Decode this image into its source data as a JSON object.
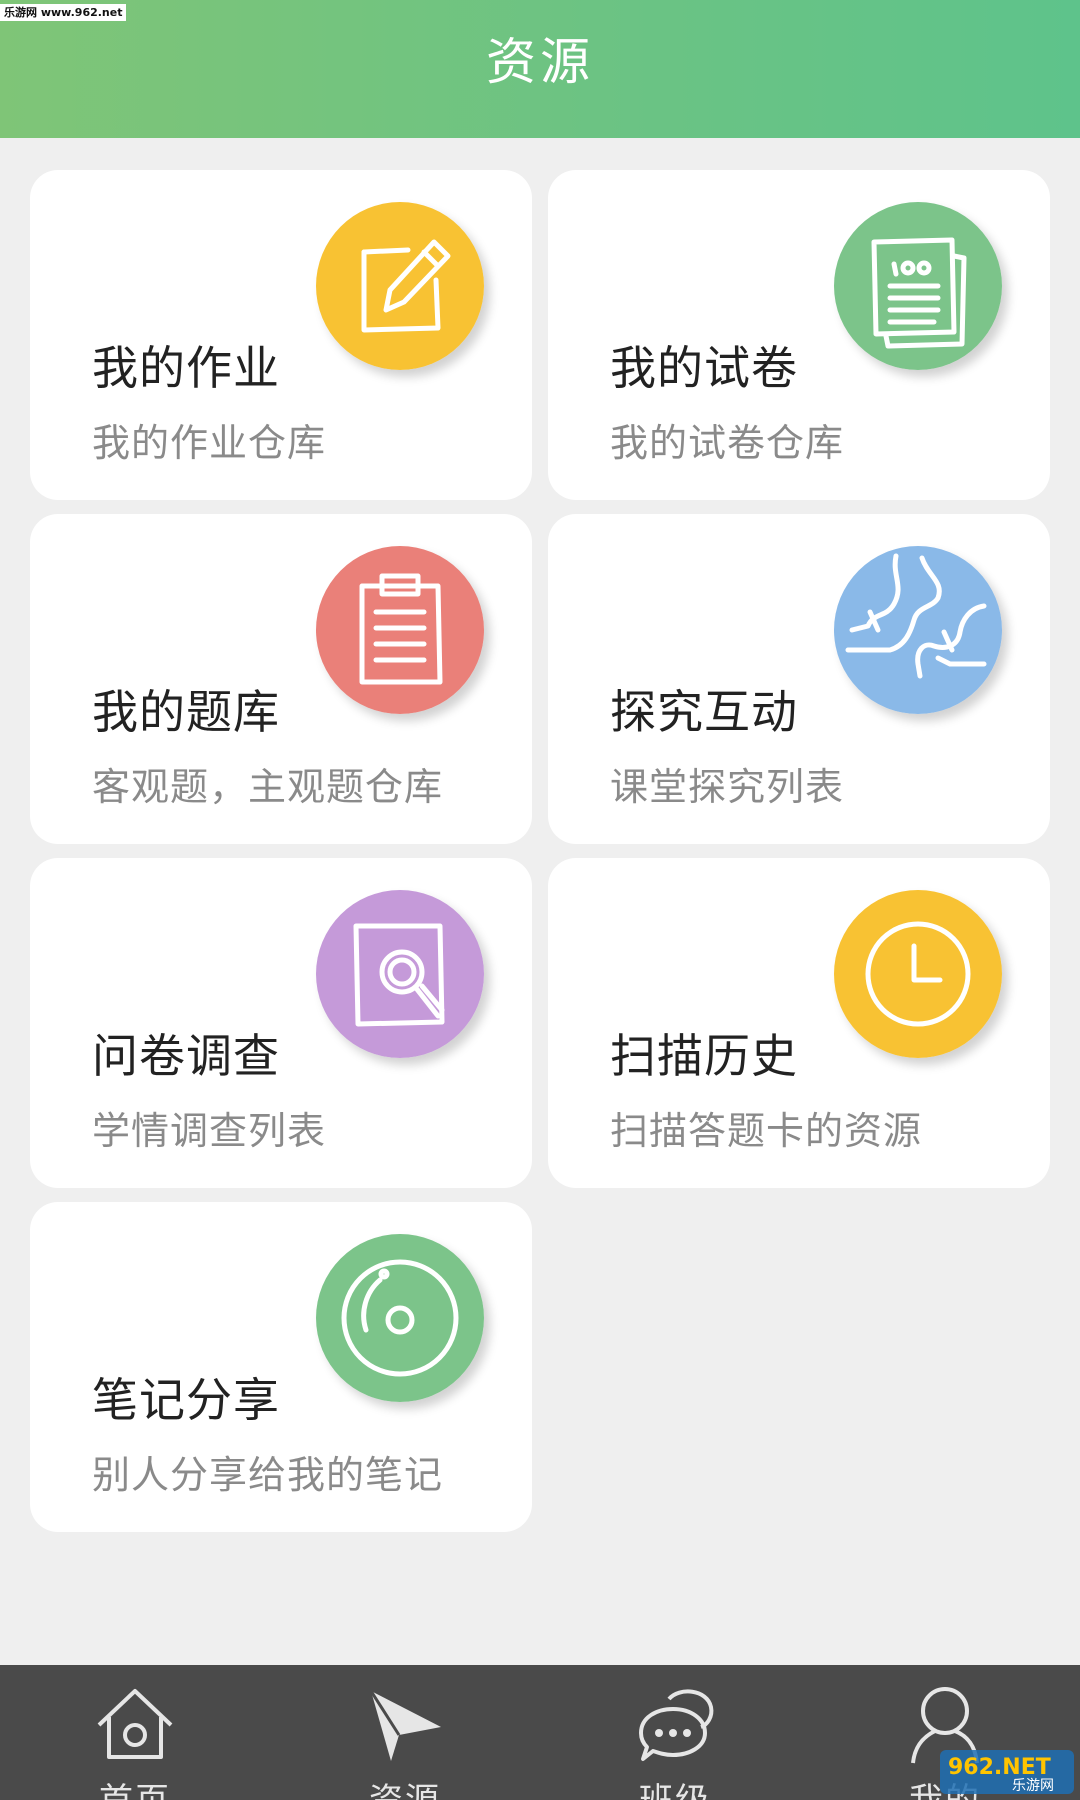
{
  "header": {
    "title": "资源",
    "watermark": "乐游网 www.962.net"
  },
  "cards": [
    {
      "title": "我的作业",
      "subtitle": "我的作业仓库",
      "icon": "homework-pencil-icon",
      "color": "#f8c233"
    },
    {
      "title": "我的试卷",
      "subtitle": "我的试卷仓库",
      "icon": "exam-paper-icon",
      "color": "#7cc48a"
    },
    {
      "title": "我的题库",
      "subtitle": "客观题，主观题仓库",
      "icon": "clipboard-icon",
      "color": "#ea8079"
    },
    {
      "title": "探究互动",
      "subtitle": "课堂探究列表",
      "icon": "interaction-icon",
      "color": "#8ab9e8"
    },
    {
      "title": "问卷调查",
      "subtitle": "学情调查列表",
      "icon": "survey-search-icon",
      "color": "#c59ad9"
    },
    {
      "title": "扫描历史",
      "subtitle": "扫描答题卡的资源",
      "icon": "clock-icon",
      "color": "#f8c233"
    },
    {
      "title": "笔记分享",
      "subtitle": "别人分享给我的笔记",
      "icon": "disc-icon",
      "color": "#7cc48a"
    }
  ],
  "tabbar": {
    "tabs": [
      {
        "label": "首页",
        "icon": "home-icon"
      },
      {
        "label": "资源",
        "icon": "paper-plane-icon",
        "active": true
      },
      {
        "label": "班级",
        "icon": "chat-bubbles-icon"
      },
      {
        "label": "我的",
        "icon": "user-icon"
      }
    ]
  },
  "watermark_bottom": {
    "brand": "962.NET",
    "site": "乐游网"
  },
  "colors": {
    "background": "#efefef",
    "header_start": "#7fc577",
    "header_end": "#5ec38b",
    "tabbar": "#4a4a4a"
  }
}
